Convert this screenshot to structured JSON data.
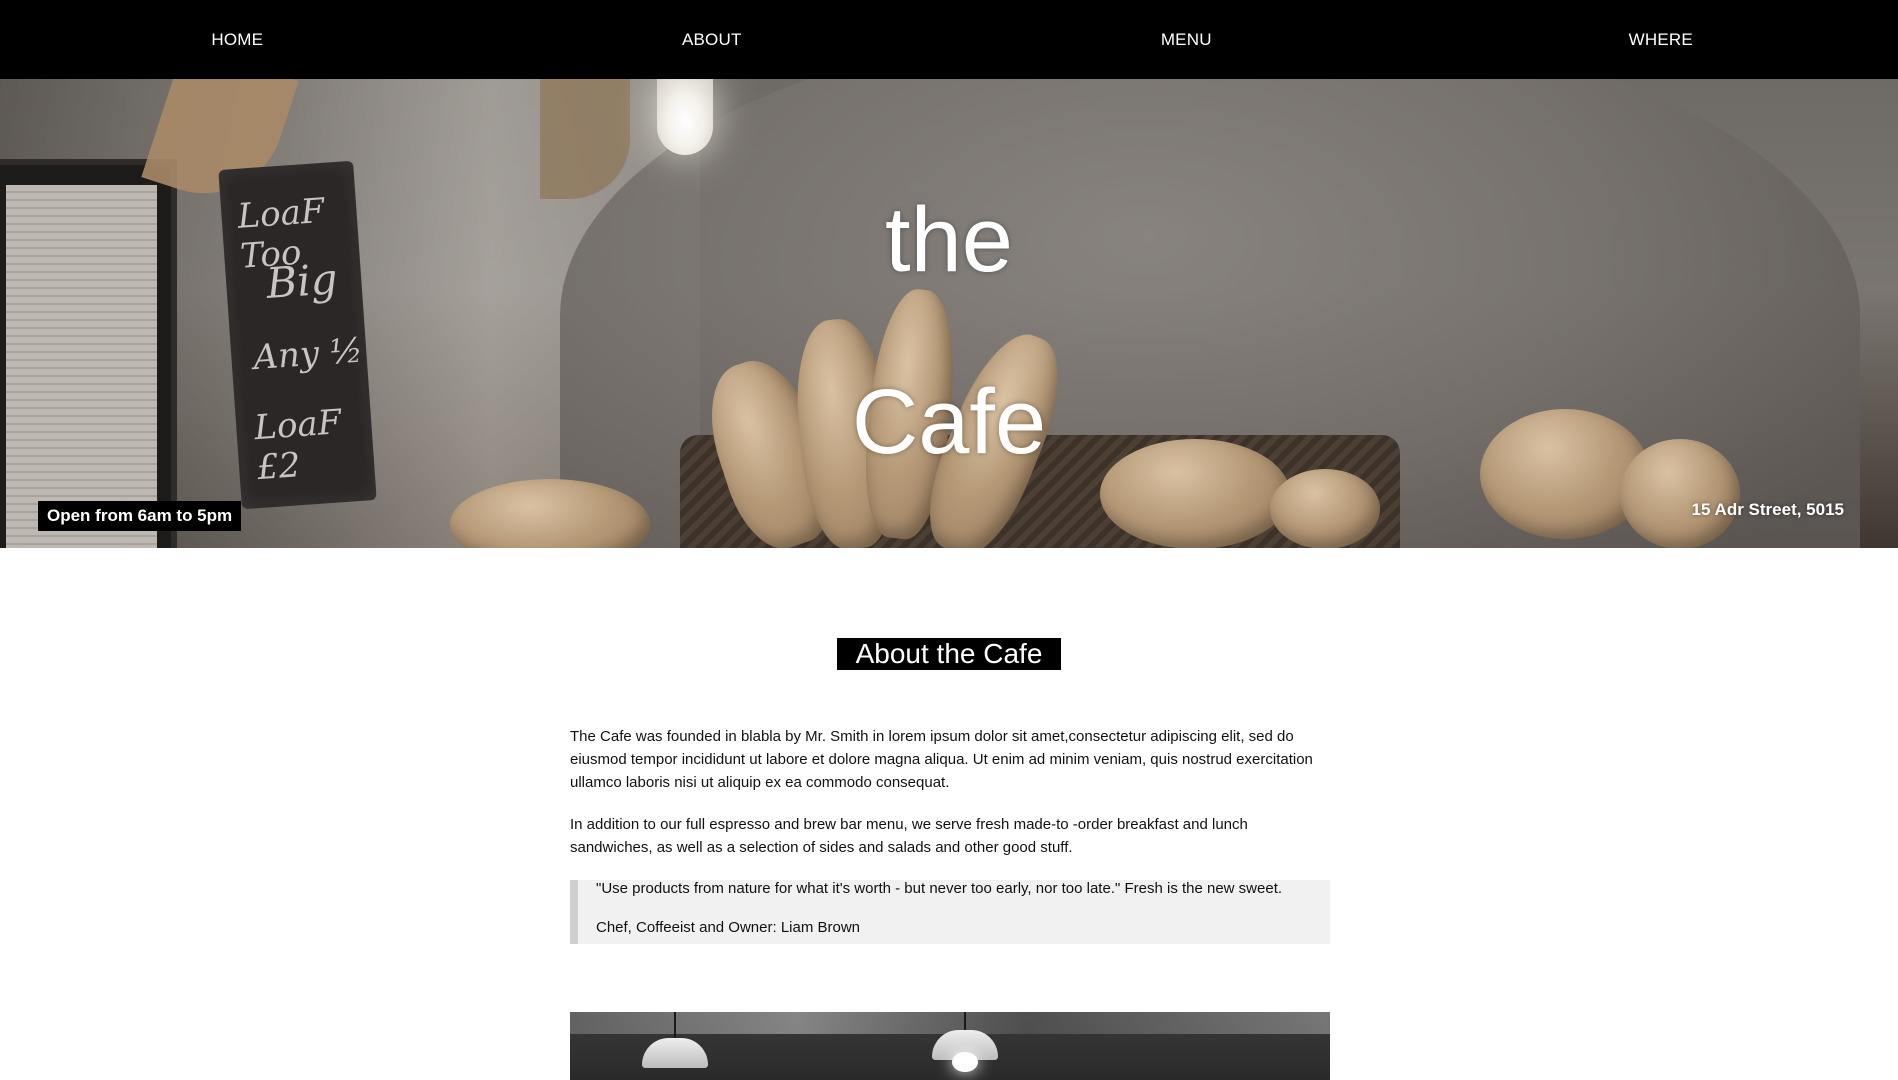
{
  "nav": {
    "items": [
      {
        "label": "HOME"
      },
      {
        "label": "ABOUT"
      },
      {
        "label": "MENU"
      },
      {
        "label": "WHERE"
      }
    ]
  },
  "hero": {
    "title_line1": "the",
    "title_line2": "Cafe",
    "hours": "Open from 6am to 5pm",
    "address": "15 Adr Street, 5015",
    "chalkboard_lines": [
      "LoaF Too",
      "Big",
      "Any ½",
      "LoaF £2"
    ]
  },
  "about": {
    "heading": "About the Cafe",
    "paragraph1": "The Cafe was founded in blabla by Mr. Smith in lorem ipsum dolor sit amet,consectetur adipiscing elit, sed do eiusmod tempor incididunt ut labore et dolore magna aliqua. Ut enim ad minim veniam, quis nostrud exercitation ullamco laboris nisi ut aliquip ex ea commodo consequat.",
    "paragraph2": "In addition to our full espresso and brew bar menu, we serve fresh made-to -order breakfast and lunch sandwiches, as well as a selection of sides and salads and other good stuff.",
    "quote": "\"Use products from nature for what it's worth - but never too early, nor too late.\" Fresh is the new sweet.",
    "quote_author": "Chef, Coffeeist and Owner: Liam Brown"
  },
  "colors": {
    "nav_bg": "#000000",
    "heading_bg": "#000000",
    "quote_bg": "#f1f1f1",
    "quote_border": "#cfcfcf"
  }
}
